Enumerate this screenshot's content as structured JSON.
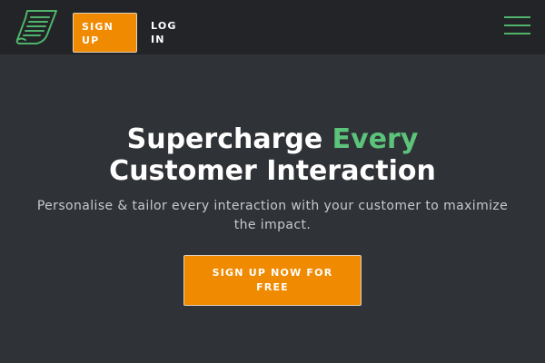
{
  "navbar": {
    "logo_icon": "receipt-document-icon",
    "signup_label": "SIGN UP",
    "login_label": "LOG IN",
    "menu_icon": "hamburger-menu-icon"
  },
  "hero": {
    "title_part1": "Supercharge ",
    "title_accent": "Every",
    "title_part2": "Customer Interaction",
    "subtitle": "Personalise & tailor every interaction with your customer to maximize the impact.",
    "cta_label": "SIGN UP NOW FOR FREE"
  },
  "colors": {
    "background": "#2f3236",
    "navbar": "#222427",
    "accent_green": "#5cc37a",
    "button_orange": "#f08a00"
  }
}
